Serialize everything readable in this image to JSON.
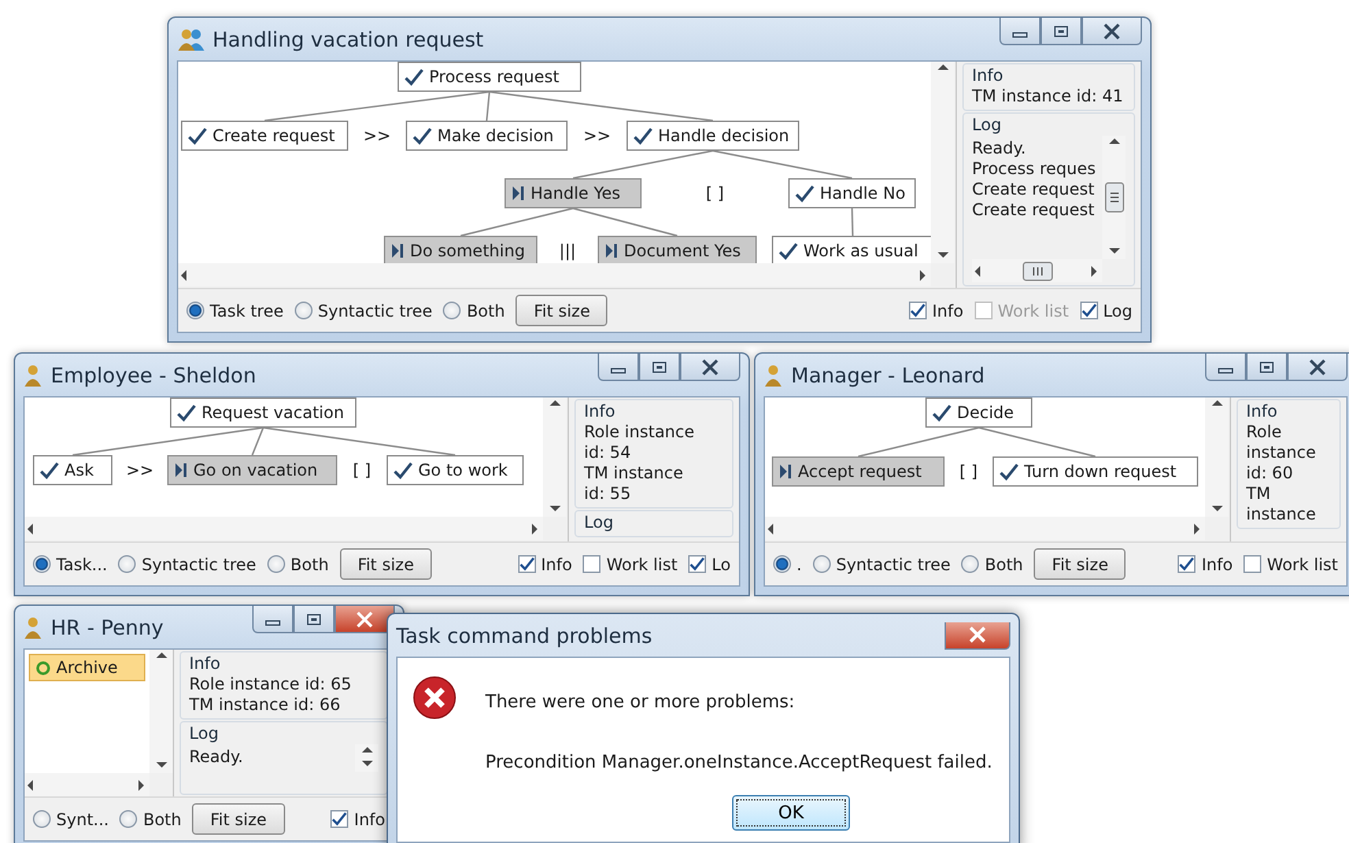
{
  "windows": [
    {
      "kind": "task",
      "title": "Handling vacation request",
      "tree": {
        "label": "Process request",
        "done": true,
        "operators": [
          ">>",
          ">>"
        ],
        "children": [
          {
            "label": "Create request",
            "done": true
          },
          {
            "label": "Make decision",
            "done": true
          },
          {
            "label": "Handle decision",
            "done": true,
            "operators": [
              "[ ]"
            ],
            "children": [
              {
                "label": "Handle Yes",
                "done": false,
                "operators": [
                  "|||"
                ],
                "children": [
                  {
                    "label": "Do something",
                    "done": false
                  },
                  {
                    "label": "Document Yes",
                    "done": false
                  }
                ]
              },
              {
                "label": "Handle No",
                "done": true,
                "children": [
                  {
                    "label": "Work as usual",
                    "done": true
                  }
                ]
              }
            ]
          }
        ]
      },
      "info": {
        "title": "Info",
        "lines": [
          "TM instance id: 41"
        ]
      },
      "log": {
        "title": "Log",
        "lines": [
          "Ready.",
          "Process reques",
          "Create request",
          "Create request"
        ]
      },
      "view_options": [
        {
          "label": "Task tree",
          "selected": true
        },
        {
          "label": "Syntactic tree",
          "selected": false
        },
        {
          "label": "Both",
          "selected": false
        }
      ],
      "fit_button": "Fit size",
      "panels": [
        {
          "label": "Info",
          "checked": true,
          "disabled": false
        },
        {
          "label": "Work list",
          "checked": false,
          "disabled": true
        },
        {
          "label": "Log",
          "checked": true,
          "disabled": false
        }
      ]
    },
    {
      "kind": "task",
      "title": "Employee - Sheldon",
      "tree": {
        "label": "Request vacation",
        "done": true,
        "operators": [
          ">>",
          "[ ]"
        ],
        "children": [
          {
            "label": "Ask",
            "done": true
          },
          {
            "label": "Go on vacation",
            "done": false
          },
          {
            "label": "Go to work",
            "done": true
          }
        ]
      },
      "info": {
        "title": "Info",
        "lines": [
          "Role instance",
          "id: 54",
          "TM instance",
          "id: 55"
        ]
      },
      "log": {
        "title": "Log"
      },
      "view_options": [
        {
          "label": "Task...",
          "selected": true
        },
        {
          "label": "Syntactic tree",
          "selected": false
        },
        {
          "label": "Both",
          "selected": false
        }
      ],
      "fit_button": "Fit size",
      "panels": [
        {
          "label": "Info",
          "checked": true,
          "disabled": false
        },
        {
          "label": "Work list",
          "checked": false,
          "disabled": false
        },
        {
          "label": "Lo",
          "checked": true,
          "disabled": false
        }
      ]
    },
    {
      "kind": "task",
      "title": "Manager - Leonard",
      "tree": {
        "label": "Decide",
        "done": true,
        "operators": [
          "[ ]"
        ],
        "children": [
          {
            "label": "Accept request",
            "done": false
          },
          {
            "label": "Turn down request",
            "done": true
          }
        ]
      },
      "info": {
        "title": "Info",
        "lines": [
          "Role",
          "instance",
          "id: 60",
          "TM",
          "instance"
        ]
      },
      "view_options": [
        {
          "label": ".",
          "selected": true
        },
        {
          "label": "Syntactic tree",
          "selected": false
        },
        {
          "label": "Both",
          "selected": false
        }
      ],
      "fit_button": "Fit size",
      "panels": [
        {
          "label": "Info",
          "checked": true,
          "disabled": false
        },
        {
          "label": "Work list",
          "checked": false,
          "disabled": false
        }
      ]
    },
    {
      "kind": "list",
      "title": "HR - Penny",
      "items": [
        {
          "label": "Archive",
          "selected": true
        }
      ],
      "info": {
        "title": "Info",
        "lines": [
          "Role instance id: 65",
          "TM instance id: 66"
        ]
      },
      "log": {
        "title": "Log",
        "lines": [
          "Ready."
        ]
      },
      "view_options": [
        {
          "label": "Synt...",
          "selected": false
        },
        {
          "label": "Both",
          "selected": false
        }
      ],
      "fit_button": "Fit size",
      "panels": [
        {
          "label": "Info",
          "checked": true,
          "disabled": false
        }
      ]
    }
  ],
  "dialog": {
    "title": "Task command problems",
    "heading": "There were one or more problems:",
    "message": "Precondition Manager.oneInstance.AcceptRequest failed.",
    "button": "OK"
  }
}
